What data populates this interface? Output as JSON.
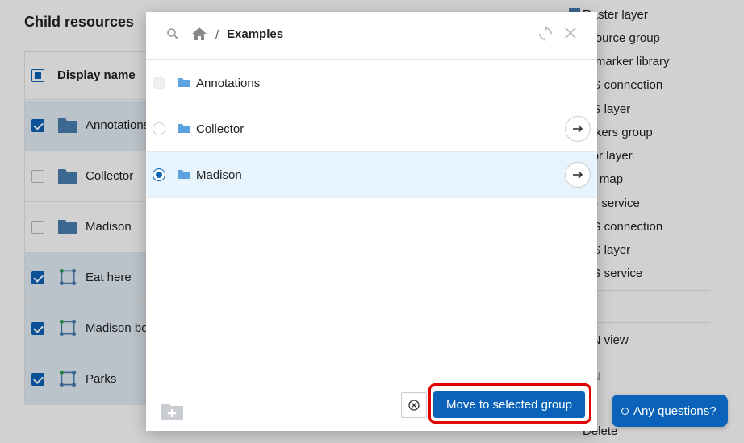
{
  "background": {
    "title": "Child resources",
    "table": {
      "header": "Display name",
      "rows": [
        {
          "label": "Annotations",
          "checked": true,
          "icon": "folder-icon"
        },
        {
          "label": "Collector",
          "checked": false,
          "icon": "folder-icon"
        },
        {
          "label": "Madison",
          "checked": false,
          "icon": "folder-icon"
        },
        {
          "label": "Eat here",
          "checked": true,
          "icon": "vector-layer-icon"
        },
        {
          "label": "Madison bo",
          "checked": true,
          "icon": "vector-layer-icon"
        },
        {
          "label": "Parks",
          "checked": true,
          "icon": "vector-layer-icon"
        }
      ]
    },
    "right_menu": {
      "items": [
        "Raster layer",
        "esource group",
        "G marker library",
        "MS connection",
        "MS layer",
        "ackers group",
        "ctor layer",
        "eb map",
        "FS service",
        "MS connection",
        "MS layer",
        "MS service"
      ],
      "section_a": "A",
      "section_a_items": [
        "ON view"
      ],
      "section_b": "ON",
      "section_b_items": [
        "da",
        "Delete"
      ]
    }
  },
  "dialog": {
    "breadcrumb": {
      "separator": "/",
      "current": "Examples"
    },
    "items": [
      {
        "name": "Annotations",
        "state": "disabled"
      },
      {
        "name": "Collector",
        "state": "unselected"
      },
      {
        "name": "Madison",
        "state": "selected"
      }
    ],
    "move_button": "Move to selected group"
  },
  "chat": {
    "label": "Any questions?"
  },
  "colors": {
    "primary": "#0a63b8",
    "highlight": "#e00000",
    "selected_row": "#e7f4fd"
  }
}
